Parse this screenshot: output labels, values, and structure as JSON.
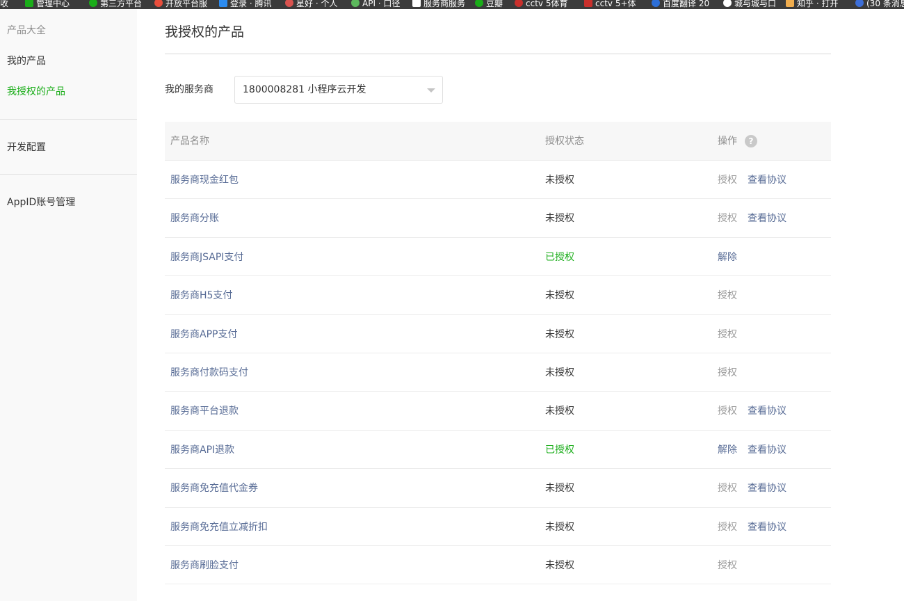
{
  "bookmarks": [
    {
      "label": "收",
      "color": "#3b3b3b"
    },
    {
      "label": "管理中心",
      "color": "#1aad19"
    },
    {
      "label": "第三方平台",
      "color": "#1aad19"
    },
    {
      "label": "开放平台服",
      "color": "#e94e3c"
    },
    {
      "label": "登录 · 腾讯",
      "color": "#2d8cf0"
    },
    {
      "label": "星好 · 个人",
      "color": "#d9534f"
    },
    {
      "label": "API · 口径",
      "color": "#5cb85c"
    },
    {
      "label": "服务商服务",
      "color": "#ffffff"
    },
    {
      "label": "豆瓣",
      "color": "#1aad19"
    },
    {
      "label": "cctv 5体育",
      "color": "#c9302c"
    },
    {
      "label": "cctv 5+体",
      "color": "#c9302c"
    },
    {
      "label": "百度翻译 20",
      "color": "#2d6fd8"
    },
    {
      "label": "城与城与口",
      "color": "#ffffff"
    },
    {
      "label": "知乎 · 打开",
      "color": "#f0ad4e"
    },
    {
      "label": "(30 条消息",
      "color": "#3c6ed8"
    }
  ],
  "sidebar": {
    "group_title": "产品大全",
    "my_products": "我的产品",
    "my_authorized_products": "我授权的产品",
    "dev_config": "开发配置",
    "appid_manage": "AppID账号管理"
  },
  "page": {
    "title": "我授权的产品",
    "provider_label": "我的服务商",
    "provider_value": "1800008281 小程序云开发"
  },
  "table": {
    "headers": {
      "name": "产品名称",
      "status": "授权状态",
      "action": "操作"
    },
    "help_icon": "?",
    "rows": [
      {
        "name": "服务商现金红包",
        "status": "未授权",
        "action1": "授权",
        "action2": "查看协议"
      },
      {
        "name": "服务商分账",
        "status": "未授权",
        "action1": "授权",
        "action2": "查看协议"
      },
      {
        "name": "服务商JSAPI支付",
        "status": "已授权",
        "action1": "解除",
        "action2": ""
      },
      {
        "name": "服务商H5支付",
        "status": "未授权",
        "action1": "授权",
        "action2": ""
      },
      {
        "name": "服务商APP支付",
        "status": "未授权",
        "action1": "授权",
        "action2": ""
      },
      {
        "name": "服务商付款码支付",
        "status": "未授权",
        "action1": "授权",
        "action2": ""
      },
      {
        "name": "服务商平台退款",
        "status": "未授权",
        "action1": "授权",
        "action2": "查看协议"
      },
      {
        "name": "服务商API退款",
        "status": "已授权",
        "action1": "解除",
        "action2": "查看协议"
      },
      {
        "name": "服务商免充值代金券",
        "status": "未授权",
        "action1": "授权",
        "action2": "查看协议"
      },
      {
        "name": "服务商免充值立减折扣",
        "status": "未授权",
        "action1": "授权",
        "action2": "查看协议"
      },
      {
        "name": "服务商刷脸支付",
        "status": "未授权",
        "action1": "授权",
        "action2": ""
      }
    ]
  },
  "colors": {
    "accent_green": "#1aad19",
    "link_blue": "#576b95",
    "muted": "#9a9a9a"
  }
}
